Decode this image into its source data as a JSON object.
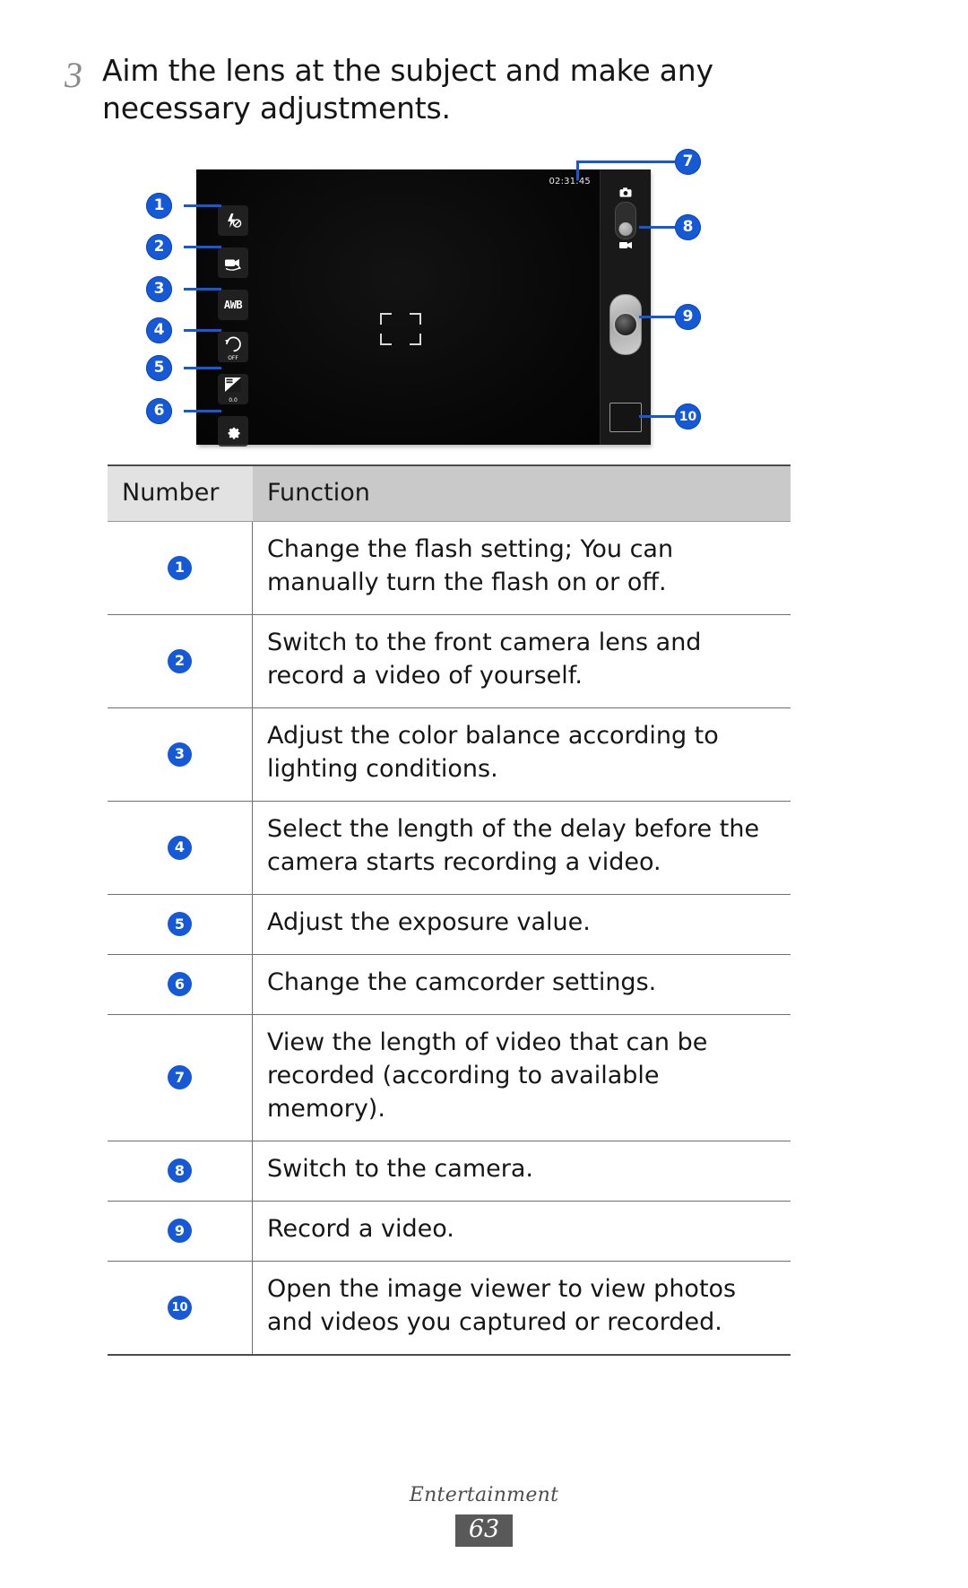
{
  "step": {
    "number": "3",
    "text": "Aim the lens at the subject and make any necessary adjustments."
  },
  "figure": {
    "caption_alt": "Camcorder viewfinder screen with numbered callouts",
    "timer": "02:31:45",
    "icons": {
      "flash_off": "flash-off-icon",
      "switch_lens": "switch-camera-lens-icon",
      "white_balance": "AWB",
      "timer_off_label": "OFF",
      "exposure_value": "0.0",
      "settings": "gear-icon",
      "camera_mode": "camera-icon",
      "video_mode": "camcorder-icon"
    },
    "callouts": [
      "1",
      "2",
      "3",
      "4",
      "5",
      "6",
      "7",
      "8",
      "9",
      "10"
    ],
    "accent_color": "#1559d6"
  },
  "table": {
    "headers": {
      "number": "Number",
      "function": "Function"
    },
    "rows": [
      {
        "number": "1",
        "function": "Change the flash setting; You can manually turn the flash on or off."
      },
      {
        "number": "2",
        "function": "Switch to the front camera lens and record a video of yourself."
      },
      {
        "number": "3",
        "function": "Adjust the color balance according to lighting conditions."
      },
      {
        "number": "4",
        "function": "Select the length of the delay before the camera starts recording a video."
      },
      {
        "number": "5",
        "function": "Adjust the exposure value."
      },
      {
        "number": "6",
        "function": "Change the camcorder settings."
      },
      {
        "number": "7",
        "function": "View the length of video that can be recorded (according to available memory)."
      },
      {
        "number": "8",
        "function": "Switch to the camera."
      },
      {
        "number": "9",
        "function": "Record a video."
      },
      {
        "number": "10",
        "function": "Open the image viewer to view photos and videos you captured or recorded."
      }
    ]
  },
  "footer": {
    "section": "Entertainment",
    "page": "63"
  }
}
